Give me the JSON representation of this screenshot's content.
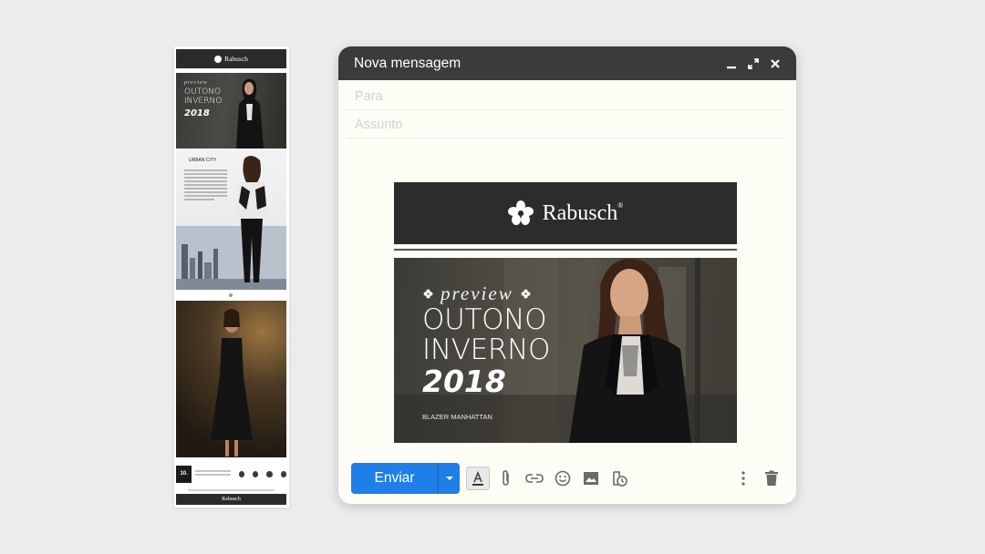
{
  "strip": {
    "brand": "Rabusch",
    "hero_preview": "preview",
    "hero_line1": "OUTONO",
    "hero_line2": "INVERNO",
    "hero_year": "2018",
    "urban_title": "URBAN CITY",
    "info_badge": "10.",
    "footer_brand": "Rabusch"
  },
  "compose": {
    "window_title": "Nova mensagem",
    "to_placeholder": "Para",
    "subject_placeholder": "Assunto",
    "send_label": "Enviar",
    "accent_color": "#1f7fe8"
  },
  "email": {
    "brand": "Rabusch",
    "registered": "®",
    "preview_label": "preview",
    "headline_line1": "OUTONO",
    "headline_line2": "INVERNO",
    "headline_year": "2018",
    "caption": "BLAZER MANHATTAN"
  },
  "icons": [
    "minimize-icon",
    "expand-icon",
    "close-icon",
    "format-text-icon",
    "attach-icon",
    "link-icon",
    "emoji-icon",
    "image-icon",
    "confidential-icon",
    "more-options-icon",
    "trash-icon"
  ]
}
